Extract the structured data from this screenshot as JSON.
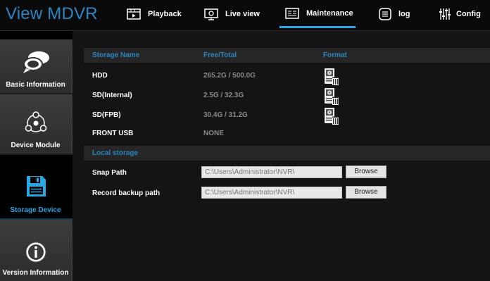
{
  "header": {
    "app_title": "View MDVR",
    "tabs": [
      {
        "label": "Playback",
        "icon": "playback-icon"
      },
      {
        "label": "Live view",
        "icon": "live-view-icon"
      },
      {
        "label": "Maintenance",
        "icon": "maintenance-icon",
        "active": true
      },
      {
        "label": "log",
        "icon": "log-icon"
      },
      {
        "label": "Config",
        "icon": "config-icon"
      }
    ]
  },
  "sidebar": {
    "items": [
      {
        "label": "Basic Information",
        "icon": "chat-bubble-icon"
      },
      {
        "label": "Device Module",
        "icon": "module-icon"
      },
      {
        "label": "Storage Device",
        "icon": "floppy-disk-icon",
        "active": true
      },
      {
        "label": "Version Information",
        "icon": "info-icon"
      }
    ]
  },
  "storage": {
    "headers": {
      "name": "Storage Name",
      "free_total": "Free/Total",
      "format": "Format"
    },
    "rows": [
      {
        "name": "HDD",
        "value": "265.2G / 500.0G",
        "has_format": true
      },
      {
        "name": "SD(Internal)",
        "value": "2.5G / 32.3G",
        "has_format": true
      },
      {
        "name": "SD(FPB)",
        "value": "30.4G / 31.2G",
        "has_format": true
      },
      {
        "name": "FRONT USB",
        "value": "NONE",
        "has_format": false
      }
    ]
  },
  "local_storage": {
    "title": "Local storage",
    "snap_label": "Snap Path",
    "snap_value": "C:\\Users\\Administrator\\NVR\\",
    "record_label": "Record backup path",
    "record_value": "C:\\Users\\Administrator\\NVR\\",
    "browse_label": "Browse"
  },
  "colors": {
    "accent": "#29a6e4",
    "title_blue": "#2a86c4",
    "background": "#141414"
  }
}
